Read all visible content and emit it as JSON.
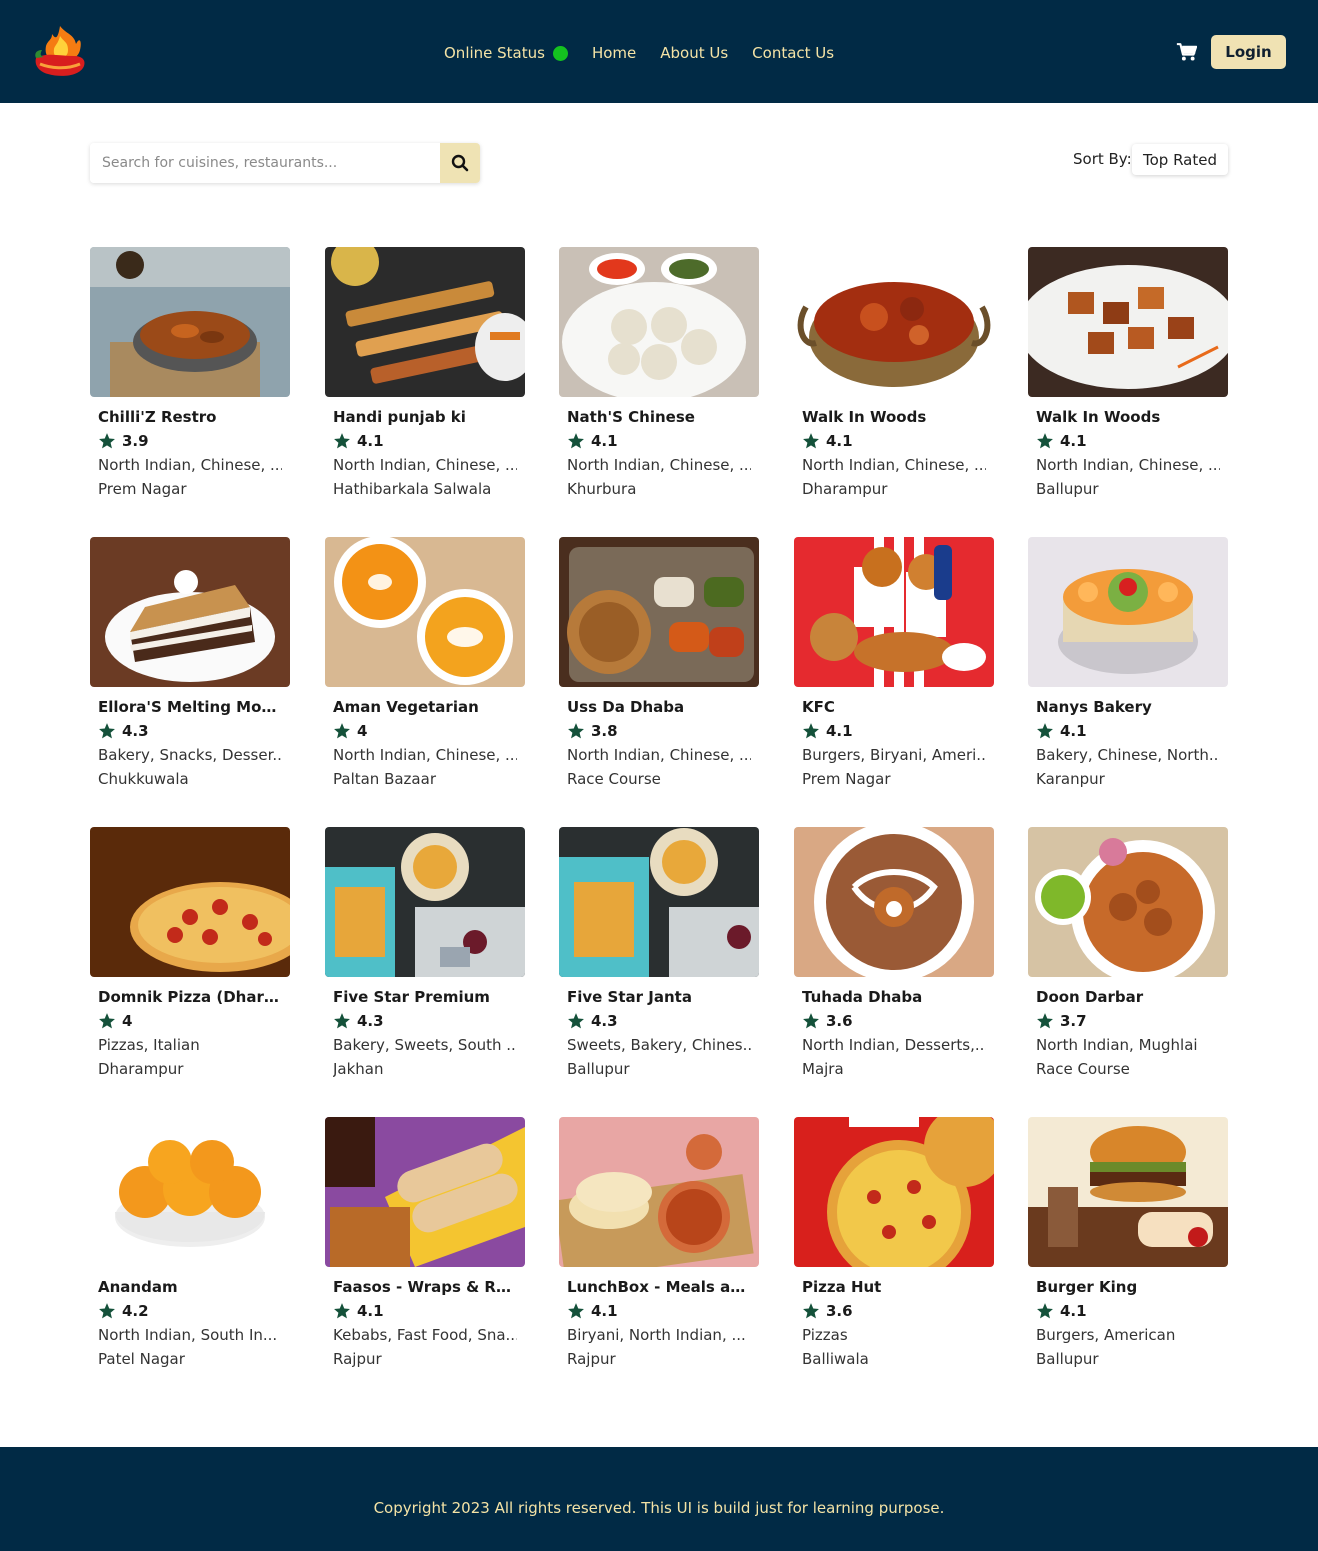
{
  "header": {
    "nav": [
      "Online Status",
      "Home",
      "About Us",
      "Contact Us"
    ],
    "online_status_color": "#14c21f",
    "cart_icon": "shopping-cart-icon",
    "login_label": "Login",
    "logo_icon": "chili-fire-logo"
  },
  "search": {
    "placeholder": "Search for cuisines, restaurants...",
    "value": "",
    "button_icon": "search-icon"
  },
  "sort": {
    "label": "Sort By:",
    "selected": "Top Rated"
  },
  "restaurants": [
    {
      "name": "Chilli'Z Restro",
      "rating": "3.9",
      "cuisines": "North Indian, Chinese, ...",
      "area": "Prem Nagar"
    },
    {
      "name": "Handi punjab ki",
      "rating": "4.1",
      "cuisines": "North Indian, Chinese, ...",
      "area": "Hathibarkala Salwala"
    },
    {
      "name": "Nath'S Chinese",
      "rating": "4.1",
      "cuisines": "North Indian, Chinese, ...",
      "area": "Khurbura"
    },
    {
      "name": "Walk In Woods",
      "rating": "4.1",
      "cuisines": "North Indian, Chinese, ...",
      "area": "Dharampur"
    },
    {
      "name": "Walk In Woods",
      "rating": "4.1",
      "cuisines": "North Indian, Chinese, ...",
      "area": "Ballupur"
    },
    {
      "name": "Ellora'S Melting Mom...",
      "rating": "4.3",
      "cuisines": "Bakery, Snacks, Desser...",
      "area": "Chukkuwala"
    },
    {
      "name": "Aman Vegetarian",
      "rating": "4",
      "cuisines": "North Indian, Chinese, ...",
      "area": "Paltan Bazaar"
    },
    {
      "name": "Uss Da Dhaba",
      "rating": "3.8",
      "cuisines": "North Indian, Chinese, ...",
      "area": "Race Course"
    },
    {
      "name": "KFC",
      "rating": "4.1",
      "cuisines": "Burgers, Biryani, Ameri...",
      "area": "Prem Nagar"
    },
    {
      "name": "Nanys Bakery",
      "rating": "4.1",
      "cuisines": "Bakery, Chinese, North...",
      "area": "Karanpur"
    },
    {
      "name": "Domnik Pizza (Dhara...",
      "rating": "4",
      "cuisines": "Pizzas, Italian",
      "area": "Dharampur"
    },
    {
      "name": "Five Star Premium",
      "rating": "4.3",
      "cuisines": "Bakery, Sweets, South ...",
      "area": "Jakhan"
    },
    {
      "name": "Five Star Janta",
      "rating": "4.3",
      "cuisines": "Sweets, Bakery, Chines...",
      "area": "Ballupur"
    },
    {
      "name": "Tuhada Dhaba",
      "rating": "3.6",
      "cuisines": "North Indian, Desserts,...",
      "area": "Majra"
    },
    {
      "name": "Doon Darbar",
      "rating": "3.7",
      "cuisines": "North Indian, Mughlai",
      "area": "Race Course"
    },
    {
      "name": "Anandam",
      "rating": "4.2",
      "cuisines": "North Indian, South In...",
      "area": "Patel Nagar"
    },
    {
      "name": "Faasos - Wraps & Rolls",
      "rating": "4.1",
      "cuisines": "Kebabs, Fast Food, Sna...",
      "area": "Rajpur"
    },
    {
      "name": "LunchBox - Meals and ...",
      "rating": "4.1",
      "cuisines": "Biryani, North Indian, ...",
      "area": "Rajpur"
    },
    {
      "name": "Pizza Hut",
      "rating": "3.6",
      "cuisines": "Pizzas",
      "area": "Balliwala"
    },
    {
      "name": "Burger King",
      "rating": "4.1",
      "cuisines": "Burgers, American",
      "area": "Ballupur"
    }
  ],
  "footer": {
    "text": "Copyright 2023 All rights reserved. This UI is build just for learning purpose."
  },
  "colors": {
    "header_bg": "#012a45",
    "accent": "#f0e2b3",
    "nav_text": "#f4e3a6",
    "star": "#14513a"
  }
}
